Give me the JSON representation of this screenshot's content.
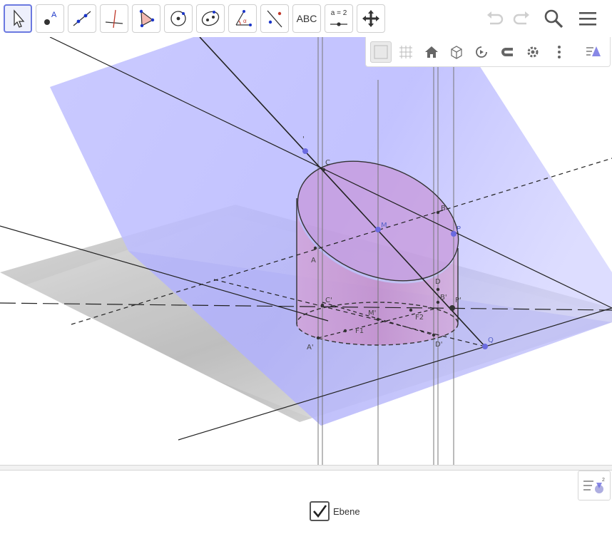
{
  "toolbar": {
    "tools": [
      {
        "name": "move-tool",
        "icon": "arrow-pointer-icon",
        "active": true
      },
      {
        "name": "point-tool",
        "icon": "point-icon",
        "label": "A"
      },
      {
        "name": "line-tool",
        "icon": "line-icon"
      },
      {
        "name": "perpendicular-line-tool",
        "icon": "perpendicular-icon"
      },
      {
        "name": "polygon-tool",
        "icon": "polygon-icon"
      },
      {
        "name": "circle-tool",
        "icon": "circle-center-icon"
      },
      {
        "name": "conic-tool",
        "icon": "ellipse-icon"
      },
      {
        "name": "angle-tool",
        "icon": "angle-icon"
      },
      {
        "name": "reflect-tool",
        "icon": "reflect-icon"
      },
      {
        "name": "text-tool",
        "icon": "text-icon",
        "label": "ABC"
      },
      {
        "name": "slider-tool",
        "icon": "slider-icon",
        "label": "a = 2"
      },
      {
        "name": "move-graphics-tool",
        "icon": "move-arrows-icon"
      }
    ],
    "right": [
      {
        "name": "undo-button",
        "icon": "undo-icon"
      },
      {
        "name": "redo-button",
        "icon": "redo-icon"
      },
      {
        "name": "search-button",
        "icon": "search-icon"
      },
      {
        "name": "menu-button",
        "icon": "menu-icon"
      }
    ]
  },
  "stylebar": {
    "buttons": [
      {
        "name": "plane-toggle",
        "icon": "plane-icon"
      },
      {
        "name": "grid-toggle",
        "icon": "grid-icon"
      },
      {
        "name": "home-button",
        "icon": "home-icon"
      },
      {
        "name": "view-direction-button",
        "icon": "cube-icon"
      },
      {
        "name": "rotate-view-button",
        "icon": "rotate-icon"
      },
      {
        "name": "point-capturing-button",
        "icon": "magnet-icon"
      },
      {
        "name": "settings-button",
        "icon": "gear-icon"
      },
      {
        "name": "more-button",
        "icon": "more-vertical-icon"
      },
      {
        "name": "algebra-toggle",
        "icon": "algebra-icon"
      }
    ]
  },
  "scene": {
    "labels": {
      "C": "C",
      "B": "B",
      "M": "M",
      "A": "A",
      "D": "D",
      "Bp": "B'",
      "Cp": "C'",
      "Dp": "D'",
      "Ap": "A'",
      "Mp": "M'",
      "F1": "F1",
      "F2": "F2",
      "Q": "Q",
      "Pp": "P'",
      "P": "P",
      "top": "'",
      "bot": "D'"
    },
    "colors": {
      "plane": "#8c8cff",
      "cylinder": "#c070c0",
      "point": "#6a6ae0"
    }
  },
  "bottom": {
    "checkbox": {
      "label": "Ebene",
      "checked": true
    }
  }
}
